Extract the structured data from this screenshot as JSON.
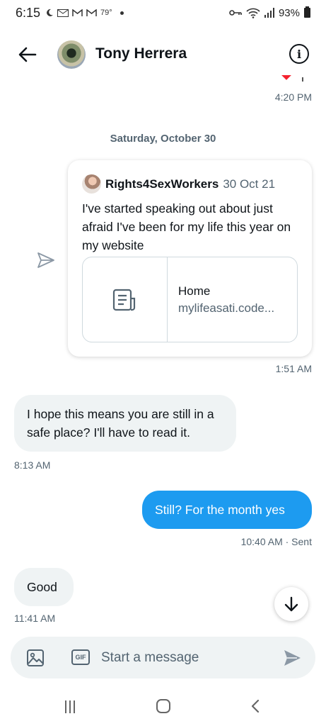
{
  "status_bar": {
    "time": "6:15",
    "temperature": "79°",
    "battery": "93%"
  },
  "header": {
    "contact_name": "Tony Herrera",
    "info_icon_char": "i"
  },
  "messages": {
    "top_timestamp": "4:20 PM",
    "date_separator": "Saturday, October 30",
    "shared_tweet": {
      "user": "Rights4SexWorkers",
      "date": "30 Oct 21",
      "text": "I've started speaking out about just afraid I've been for my life this year on my website",
      "link_title": "Home",
      "link_url": "mylifeasati.code..."
    },
    "shared_timestamp": "1:51 AM",
    "incoming_1": {
      "text": "I hope this means you are still in a safe place?  I'll have to read it.",
      "timestamp": "8:13 AM"
    },
    "outgoing_1": {
      "text": "Still? For the month yes",
      "timestamp": "10:40 AM · Sent"
    },
    "incoming_2": {
      "text": "Good",
      "timestamp": "11:41 AM"
    }
  },
  "composer": {
    "placeholder": "Start a message",
    "gif_label": "GIF"
  },
  "colors": {
    "accent": "#1d9bf0",
    "bubble_incoming": "#eff3f4",
    "secondary_text": "#536471"
  },
  "icons": [
    "back-arrow-icon",
    "info-icon",
    "send-icon",
    "image-icon",
    "gif-icon",
    "arrow-down-icon",
    "document-icon"
  ]
}
